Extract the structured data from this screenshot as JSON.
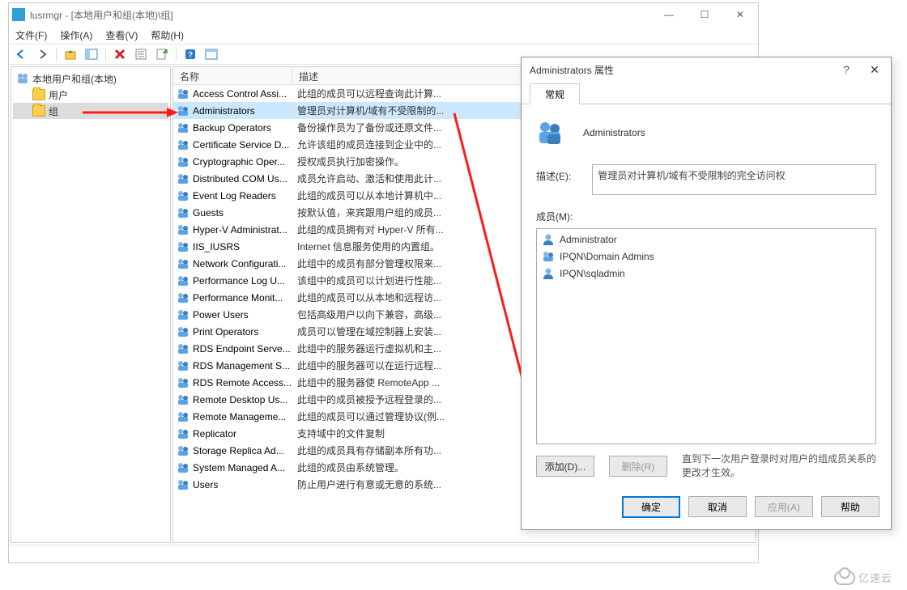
{
  "window": {
    "title": "lusrmgr - [本地用户和组(本地)\\组]",
    "menu": {
      "file": "文件(F)",
      "action": "操作(A)",
      "view": "查看(V)",
      "help": "帮助(H)"
    },
    "tree": {
      "root": "本地用户和组(本地)",
      "users": "用户",
      "groups": "组"
    },
    "columns": {
      "name": "名称",
      "desc": "描述"
    },
    "groups": [
      {
        "name": "Access Control Assi...",
        "desc": "此组的成员可以远程查询此计算..."
      },
      {
        "name": "Administrators",
        "desc": "管理员对计算机/域有不受限制的..."
      },
      {
        "name": "Backup Operators",
        "desc": "备份操作员为了备份或还原文件..."
      },
      {
        "name": "Certificate Service D...",
        "desc": "允许该组的成员连接到企业中的..."
      },
      {
        "name": "Cryptographic Oper...",
        "desc": "授权成员执行加密操作。"
      },
      {
        "name": "Distributed COM Us...",
        "desc": "成员允许启动、激活和使用此计..."
      },
      {
        "name": "Event Log Readers",
        "desc": "此组的成员可以从本地计算机中..."
      },
      {
        "name": "Guests",
        "desc": "按默认值，来宾跟用户组的成员..."
      },
      {
        "name": "Hyper-V Administrat...",
        "desc": "此组的成员拥有对 Hyper-V 所有..."
      },
      {
        "name": "IIS_IUSRS",
        "desc": "Internet 信息服务使用的内置组。"
      },
      {
        "name": "Network Configurati...",
        "desc": "此组中的成员有部分管理权限来..."
      },
      {
        "name": "Performance Log U...",
        "desc": "该组中的成员可以计划进行性能..."
      },
      {
        "name": "Performance Monit...",
        "desc": "此组的成员可以从本地和远程访..."
      },
      {
        "name": "Power Users",
        "desc": "包括高级用户以向下兼容，高级..."
      },
      {
        "name": "Print Operators",
        "desc": "成员可以管理在域控制器上安装..."
      },
      {
        "name": "RDS Endpoint Serve...",
        "desc": "此组中的服务器运行虚拟机和主..."
      },
      {
        "name": "RDS Management S...",
        "desc": "此组中的服务器可以在运行远程..."
      },
      {
        "name": "RDS Remote Access...",
        "desc": "此组中的服务器使 RemoteApp ..."
      },
      {
        "name": "Remote Desktop Us...",
        "desc": "此组中的成员被授予远程登录的..."
      },
      {
        "name": "Remote Manageme...",
        "desc": "此组的成员可以通过管理协议(例..."
      },
      {
        "name": "Replicator",
        "desc": "支持域中的文件复制"
      },
      {
        "name": "Storage Replica Ad...",
        "desc": "此组的成员具有存储副本所有功..."
      },
      {
        "name": "System Managed A...",
        "desc": "此组的成员由系统管理。"
      },
      {
        "name": "Users",
        "desc": "防止用户进行有意或无意的系统..."
      }
    ]
  },
  "dialog": {
    "title": "Administrators 属性",
    "tab": "常规",
    "group_name": "Administrators",
    "desc_label": "描述(E):",
    "desc_value": "管理员对计算机/域有不受限制的完全访问权",
    "members_label": "成员(M):",
    "members": [
      {
        "name": "Administrator",
        "type": "user"
      },
      {
        "name": "IPQN\\Domain Admins",
        "type": "group"
      },
      {
        "name": "IPQN\\sqladmin",
        "type": "user"
      }
    ],
    "add_btn": "添加(D)...",
    "remove_btn": "删除(R)",
    "note": "直到下一次用户登录时对用户的组成员关系的更改才生效。",
    "ok": "确定",
    "cancel": "取消",
    "apply": "应用(A)",
    "help": "帮助"
  },
  "watermark": "亿速云"
}
